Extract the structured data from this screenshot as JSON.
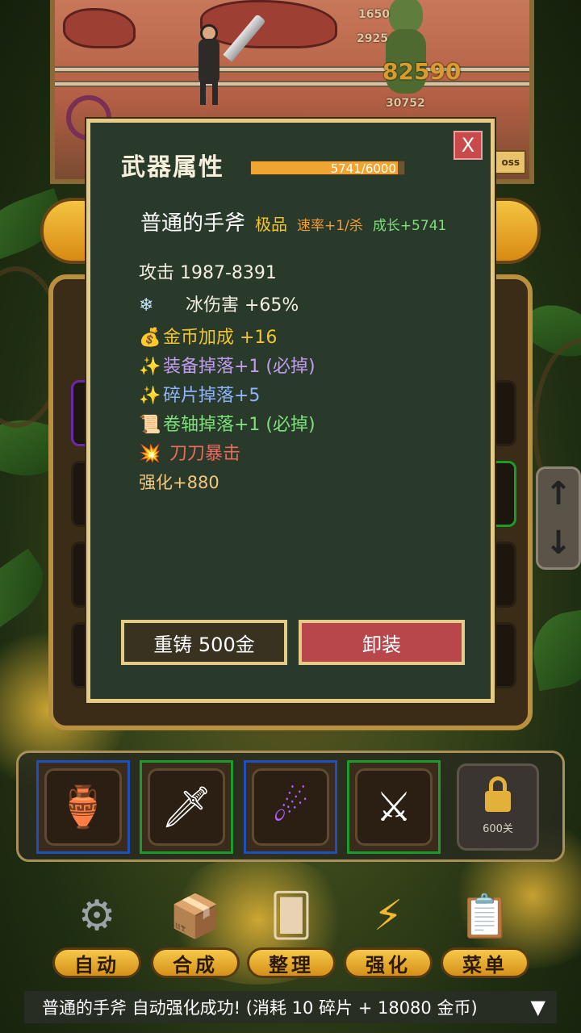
{
  "battle": {
    "damage_numbers": [
      "1650",
      "2925",
      "82590",
      "30752"
    ],
    "boss_button": "oss"
  },
  "modal": {
    "title": "武器属性",
    "progress_text": "5741/6000",
    "progress_fraction": 0.957,
    "close_label": "X",
    "item": {
      "name": "普通的手斧",
      "grade": "极品",
      "speed": "速率+1/杀",
      "growth": "成长+5741"
    },
    "stats": {
      "attack": "攻击 1987-8391",
      "ice_icon": "❄",
      "ice": "冰伤害 +65%",
      "gold_icon": "💰",
      "gold": "金币加成 +16",
      "equip_icon": "✨",
      "equip_drop": "装备掉落+1 (必掉)",
      "frag_icon": "✨",
      "frag_drop": "碎片掉落+5",
      "scroll_icon": "📜",
      "scroll_drop": "卷轴掉落+1 (必掉)",
      "crit_icon": "💥",
      "crit": "刀刀暴击",
      "enhance": "强化+880"
    },
    "recast_button": "重铸 500金",
    "unequip_button": "卸装"
  },
  "skills": {
    "items": [
      {
        "icon": "treasure-pot-icon",
        "border": "#1f4fb8"
      },
      {
        "icon": "gold-sword-icon",
        "border": "#1c9a2a"
      },
      {
        "icon": "purple-meteor-icon",
        "border": "#1f4fb8"
      },
      {
        "icon": "blue-blade-icon",
        "border": "#1c9a2a"
      }
    ],
    "locked_label": "600关"
  },
  "menu": {
    "auto": "自动",
    "merge": "合成",
    "sort": "整理",
    "enhance": "强化",
    "menu": "菜单"
  },
  "status": {
    "message": "普通的手斧 自动强化成功! (消耗 10 碎片 + 18080 金币)",
    "toggle": "▼"
  },
  "colors": {
    "modal_bg": "#293a2a",
    "modal_border": "#e6cb86",
    "grade": "#f2c431",
    "speed": "#f49c34",
    "growth": "#7ee07a",
    "crit": "#ee6a5c",
    "unequip": "#b8474c"
  }
}
